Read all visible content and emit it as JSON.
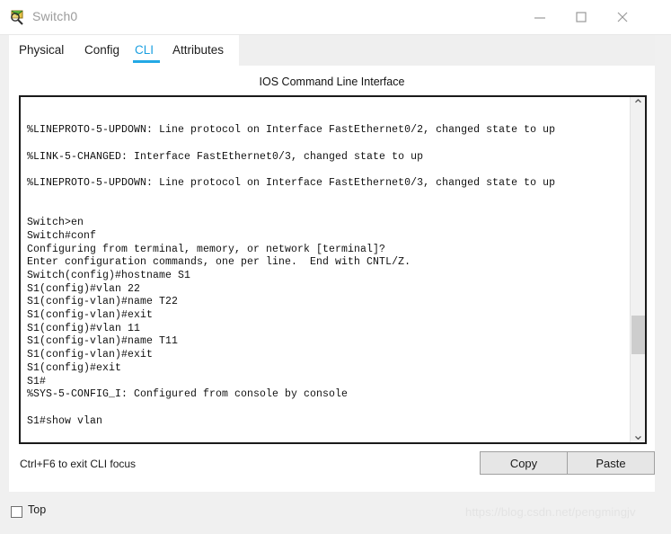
{
  "window": {
    "title": "Switch0",
    "icon": "switch-device-icon",
    "controls": {
      "minimize": "minimize-icon",
      "maximize": "maximize-icon",
      "close": "close-icon"
    }
  },
  "tabs": [
    {
      "id": "physical",
      "label": "Physical",
      "selected": false
    },
    {
      "id": "config",
      "label": "Config",
      "selected": false
    },
    {
      "id": "cli",
      "label": "CLI",
      "selected": true
    },
    {
      "id": "attributes",
      "label": "Attributes",
      "selected": false
    }
  ],
  "panel": {
    "heading": "IOS Command Line Interface",
    "console_text": "\n%LINEPROTO-5-UPDOWN: Line protocol on Interface FastEthernet0/2, changed state to up\n\n%LINK-5-CHANGED: Interface FastEthernet0/3, changed state to up\n\n%LINEPROTO-5-UPDOWN: Line protocol on Interface FastEthernet0/3, changed state to up\n\n\nSwitch>en\nSwitch#conf\nConfiguring from terminal, memory, or network [terminal]?\nEnter configuration commands, one per line.  End with CNTL/Z.\nSwitch(config)#hostname S1\nS1(config)#vlan 22\nS1(config-vlan)#name T22\nS1(config-vlan)#exit\nS1(config)#vlan 11\nS1(config-vlan)#name T11\nS1(config-vlan)#exit\nS1(config)#exit\nS1#\n%SYS-5-CONFIG_I: Configured from console by console\n\nS1#show vlan",
    "scroll_up_glyph": "⌃",
    "scroll_down_glyph": "⌄",
    "hint": "Ctrl+F6 to exit CLI focus",
    "copy_label": "Copy",
    "paste_label": "Paste"
  },
  "bottom": {
    "top_checkbox_label": "Top",
    "top_checked": false,
    "watermark": "https://blog.csdn.net/pengmingjv"
  },
  "colors": {
    "accent": "#23a9e5",
    "tab_active_text": "#1a9fe0",
    "window_chrome": "#f0f0f0",
    "panel_bg": "#ffffff",
    "console_border": "#1a1a1a",
    "button_face": "#e6e6e6",
    "scroll_thumb": "#cdcdcd",
    "watermark": "#e3e3e3"
  }
}
